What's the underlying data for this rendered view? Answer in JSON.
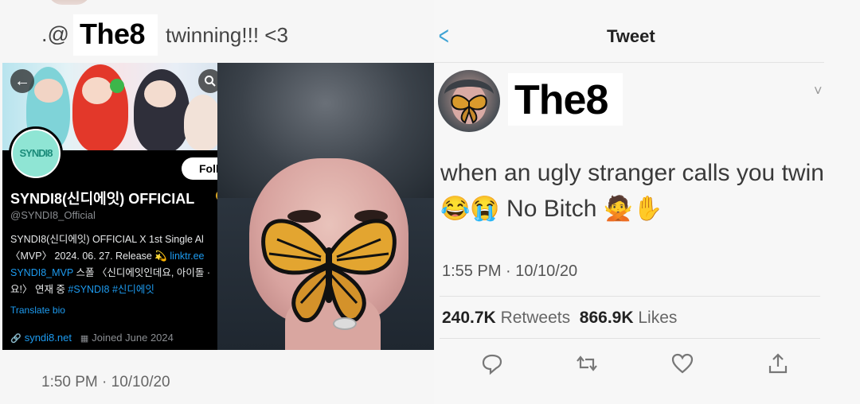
{
  "left_tweet": {
    "mention_prefix": ".@",
    "name": "The8",
    "text": "twinning!!! <3",
    "timestamp": "1:50 PM · 10/10/20",
    "profile": {
      "avatar_text": "SYNDI8",
      "follow_label": "Foll",
      "display_name": "SYNDI8(신디에잇) OFFICIAL",
      "handle": "@SYNDI8_Official",
      "bio_line1": "SYNDI8(신디에잇) OFFICIAL X  1st Single Al",
      "bio_line2_text": "〈MVP〉 2024. 06. 27. Release 💫 ",
      "bio_line2_link": "linktr.ee",
      "bio_line3_link": "SYNDI8_MVP",
      "bio_line3_text": "  스폴 〈신디에잇인데요, 아이돌 ·",
      "bio_line4_text": "요!〉 연재 중 ",
      "bio_line4_tags": "#SYNDI8 #신디에잇",
      "translate_label": "Translate bio",
      "website": "syndi8.net",
      "joined": "Joined June 2024"
    }
  },
  "right_tweet": {
    "nav_title": "Tweet",
    "name": "The8",
    "text_line1": "when an ugly stranger calls you twin",
    "text_line2": "😂😭 No Bitch 🙅✋",
    "timestamp": "1:55 PM · 10/10/20",
    "retweets_count": "240.7K",
    "retweets_label": "Retweets",
    "likes_count": "866.9K",
    "likes_label": "Likes"
  },
  "colors": {
    "link_blue": "#1d9bf0",
    "nav_blue": "#3fa3d4",
    "profile_bg": "#000000",
    "avatar_teal": "#8fe5d4"
  },
  "icons": [
    "back-arrow-icon",
    "search-icon",
    "verified-badge-icon",
    "link-icon",
    "calendar-icon",
    "chevron-left-icon",
    "chevron-down-icon",
    "reply-icon",
    "retweet-icon",
    "like-icon",
    "share-icon"
  ]
}
